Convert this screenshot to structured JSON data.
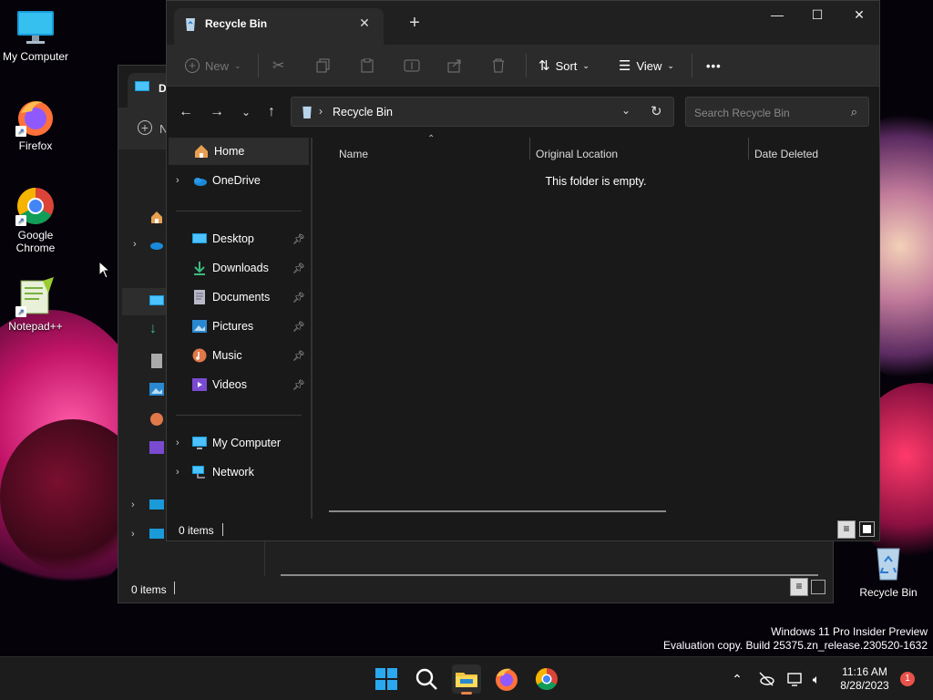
{
  "desktop": {
    "icons": [
      {
        "label": "My Computer",
        "icon": "monitor-icon"
      },
      {
        "label": "Firefox",
        "icon": "firefox-icon"
      },
      {
        "label": "Google Chrome",
        "icon": "chrome-icon"
      },
      {
        "label": "Notepad++",
        "icon": "notepadpp-icon"
      },
      {
        "label": "Recycle Bin",
        "icon": "recycle-bin-icon"
      }
    ]
  },
  "back_window": {
    "tab_label_partial": "D",
    "new_label_partial": "N",
    "status": "0 items"
  },
  "window": {
    "tab_title": "Recycle Bin",
    "toolbar": {
      "new_label": "New",
      "sort_label": "Sort",
      "view_label": "View",
      "more_label": "•••"
    },
    "address": {
      "path": "Recycle Bin"
    },
    "search": {
      "placeholder": "Search Recycle Bin"
    },
    "nav": {
      "home": "Home",
      "onedrive": "OneDrive",
      "pinned": [
        {
          "label": "Desktop"
        },
        {
          "label": "Downloads"
        },
        {
          "label": "Documents"
        },
        {
          "label": "Pictures"
        },
        {
          "label": "Music"
        },
        {
          "label": "Videos"
        }
      ],
      "my_computer": "My Computer",
      "network": "Network"
    },
    "columns": {
      "name": "Name",
      "original_location": "Original Location",
      "date_deleted": "Date Deleted"
    },
    "empty_message": "This folder is empty.",
    "status": "0 items"
  },
  "watermark": {
    "line1": "Windows 11 Pro Insider Preview",
    "line2": "Evaluation copy. Build 25375.zn_release.230520-1632"
  },
  "taskbar": {
    "time": "11:16 AM",
    "date": "8/28/2023",
    "notification_count": "1"
  },
  "colors": {
    "accent": "#4cc2ff",
    "window_bg": "#191919",
    "toolbar_bg": "#2b2b2b",
    "badge": "#e8524a"
  }
}
